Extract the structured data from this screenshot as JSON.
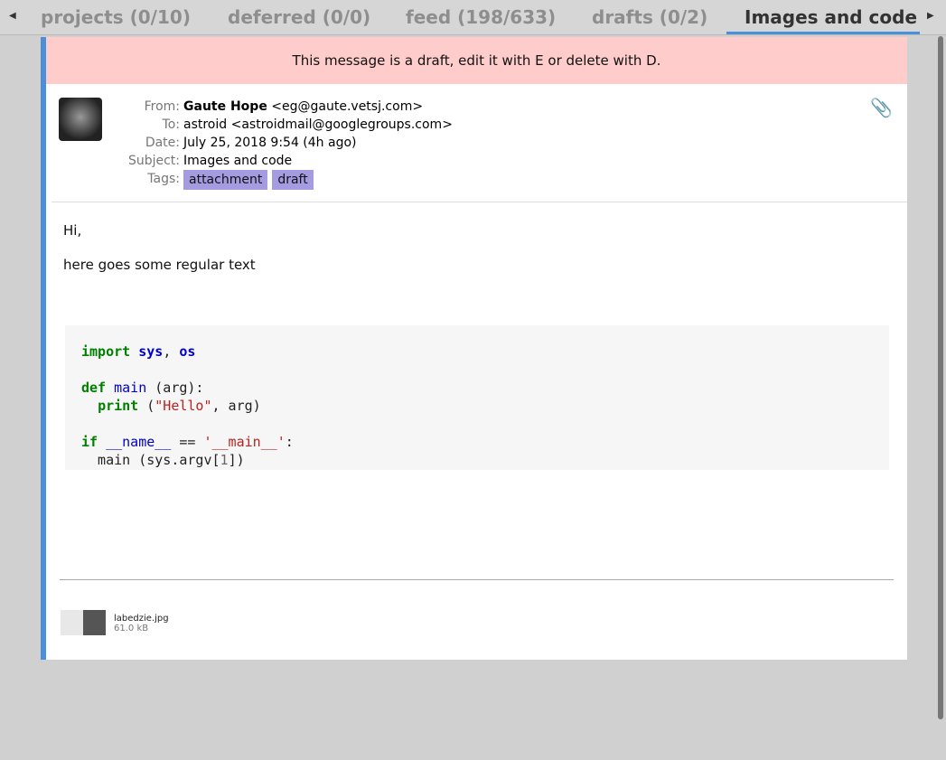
{
  "tabs": [
    {
      "label": "projects (0/10)"
    },
    {
      "label": "deferred (0/0)"
    },
    {
      "label": "feed (198/633)"
    },
    {
      "label": "drafts (0/2)"
    },
    {
      "label": "Images and code"
    }
  ],
  "banner": "This message is a draft, edit it with E or delete with D.",
  "header": {
    "from_label": "From:",
    "from_name": "Gaute Hope",
    "from_addr": "<eg@gaute.vetsj.com>",
    "to_label": "To:",
    "to": "astroid <astroidmail@googlegroups.com>",
    "date_label": "Date:",
    "date": "July 25, 2018 9:54 (4h ago)",
    "subject_label": "Subject:",
    "subject": "Images and code",
    "tags_label": "Tags:",
    "tags": [
      "attachment",
      "draft"
    ]
  },
  "body": {
    "greeting": "Hi,",
    "text": "here goes some regular text"
  },
  "attachment": {
    "name": "labedzie.jpg",
    "size": "61.0 kB"
  }
}
